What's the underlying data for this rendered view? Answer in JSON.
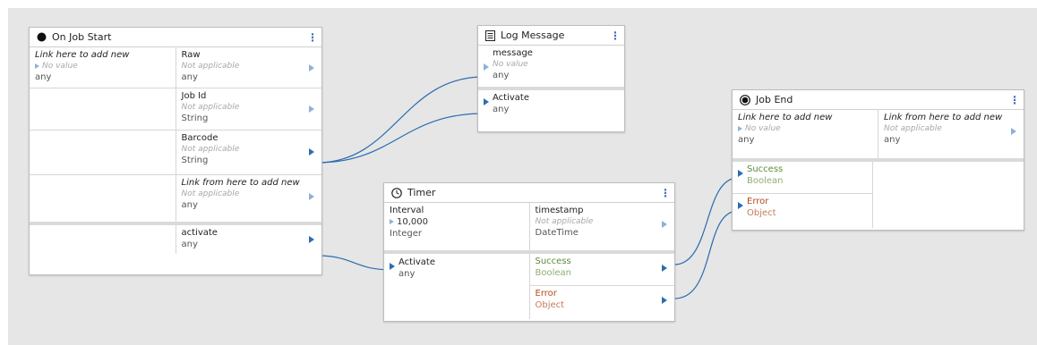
{
  "colors": {
    "canvas": "#e6e6e6",
    "wire": "#2b6cb0",
    "success": "#5e8b3a",
    "error": "#b34a1e"
  },
  "on_job_start": {
    "title": "On Job Start",
    "icon": "filled-circle-icon",
    "rows": {
      "link_new": "Link here to add new",
      "no_value": "No value",
      "any": "any",
      "raw": "Raw",
      "not_applicable": "Not applicable",
      "raw_type": "any",
      "jobid": "Job Id",
      "jobid_na": "Not applicable",
      "jobid_type": "String",
      "barcode": "Barcode",
      "barcode_na": "Not applicable",
      "barcode_type": "String",
      "link_from": "Link from here to add new",
      "link_from_na": "Not applicable",
      "link_from_type": "any",
      "activate": "activate",
      "activate_type": "any"
    }
  },
  "log_message": {
    "title": "Log Message",
    "icon": "document-icon",
    "message": "message",
    "no_value": "No value",
    "message_type": "any",
    "activate": "Activate",
    "activate_type": "any"
  },
  "timer": {
    "title": "Timer",
    "icon": "clock-icon",
    "interval": "Interval",
    "interval_value": "10,000",
    "interval_type": "Integer",
    "timestamp": "timestamp",
    "timestamp_na": "Not applicable",
    "timestamp_type": "DateTime",
    "activate": "Activate",
    "activate_type": "any",
    "success": "Success",
    "success_type": "Boolean",
    "error": "Error",
    "error_type": "Object"
  },
  "job_end": {
    "title": "Job End",
    "icon": "target-circle-icon",
    "link_new": "Link here to add new",
    "no_value": "No value",
    "link_new_type": "any",
    "link_from": "Link from here to add new",
    "link_from_na": "Not applicable",
    "link_from_type": "any",
    "success": "Success",
    "success_type": "Boolean",
    "error": "Error",
    "error_type": "Object"
  },
  "menu_glyph": "⋮"
}
